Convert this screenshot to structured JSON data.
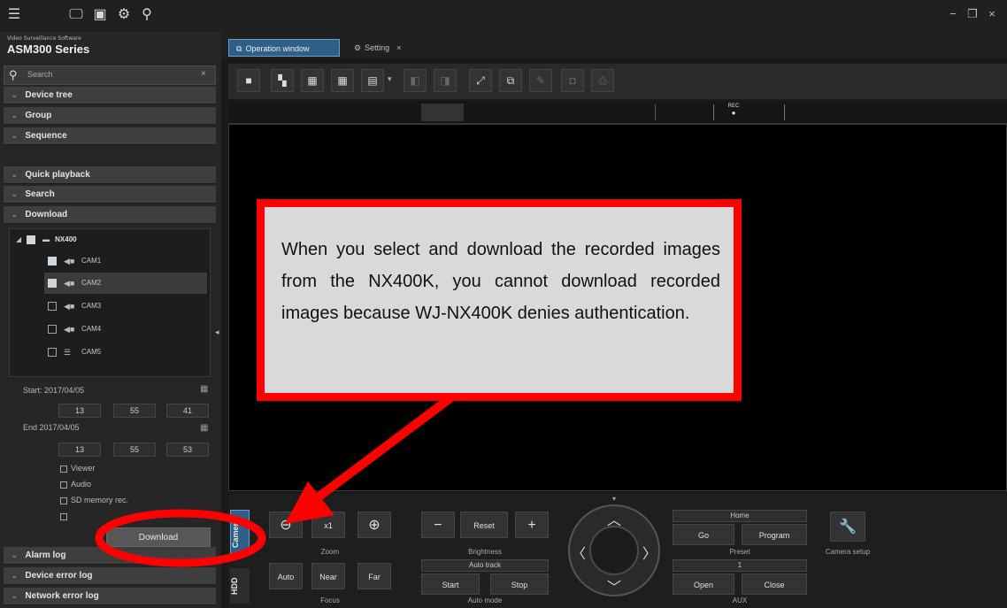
{
  "app": {
    "brand_small": "Video Surveillance Software",
    "brand_big": "ASM300 Series"
  },
  "topbar": {
    "menu_icon": "hamburger-icon",
    "icons": [
      "monitor-icon",
      "layout-icon",
      "gear-icon",
      "search-icon"
    ],
    "window_controls": [
      "−",
      "❐",
      "×"
    ]
  },
  "sidebar": {
    "search_placeholder": "Search",
    "sections_top": [
      "Device tree",
      "Group",
      "Sequence"
    ],
    "sections_mid": [
      "Quick playback",
      "Search",
      "Download"
    ],
    "sections_bottom": [
      "Alarm log",
      "Device error log",
      "Network error log"
    ],
    "tree": {
      "root": "NX400",
      "cameras": [
        {
          "label": "CAM1",
          "checked": true,
          "selected": false
        },
        {
          "label": "CAM2",
          "checked": true,
          "selected": true
        },
        {
          "label": "CAM3",
          "checked": false,
          "selected": false
        },
        {
          "label": "CAM4",
          "checked": false,
          "selected": false
        },
        {
          "label": "CAM5",
          "checked": false,
          "selected": false
        }
      ]
    },
    "start_label": "Start",
    "start_date": "2017/04/05",
    "start_time": [
      "13",
      "55",
      "41"
    ],
    "end_label": "End",
    "end_date": "2017/04/05",
    "end_time": [
      "13",
      "55",
      "53"
    ],
    "options": [
      "Viewer",
      "Audio",
      "SD memory rec."
    ],
    "download_button": "Download"
  },
  "tabs": [
    {
      "label": "Operation window",
      "active": true
    },
    {
      "label": "Setting",
      "active": false
    }
  ],
  "statusbar": {
    "rec_label": "REC"
  },
  "controls": {
    "side_tabs": [
      "Camera",
      "HDD"
    ],
    "zoom": {
      "caption": "Zoom",
      "x1": "x1"
    },
    "focus": {
      "caption": "Focus",
      "buttons": [
        "Auto",
        "Near",
        "Far"
      ]
    },
    "brightness": {
      "caption": "Brightness",
      "reset": "Reset"
    },
    "auto_mode": {
      "caption": "Auto mode",
      "select": "Auto track",
      "buttons": [
        "Start",
        "Stop"
      ]
    },
    "preset": {
      "caption": "Preset",
      "select": "Home",
      "buttons": [
        "Go",
        "Program"
      ]
    },
    "aux": {
      "caption": "AUX",
      "select": "1",
      "buttons": [
        "Open",
        "Close"
      ]
    },
    "camera_setup": "Camera setup"
  },
  "annotation": {
    "text": "When you select and download the recorded images from the NX400K, you cannot download recorded images because WJ-NX400K denies authentication.",
    "color": "#ff0000"
  }
}
